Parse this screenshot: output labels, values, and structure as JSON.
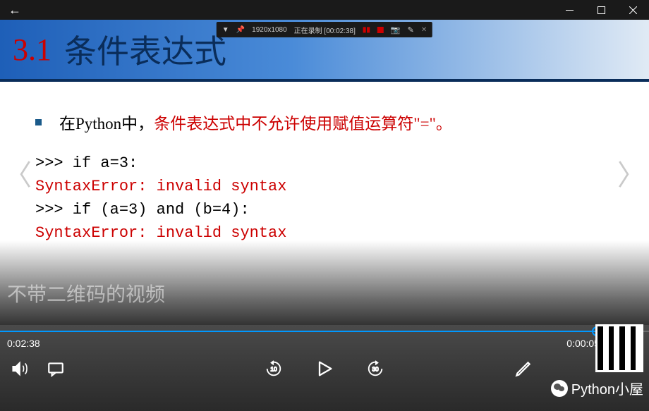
{
  "titlebar": {
    "back": "←"
  },
  "recording": {
    "resolution": "1920x1080",
    "status_label": "正在录制",
    "status_time": "[00:02:38]"
  },
  "slide": {
    "number": "3.1",
    "title": "条件表达式",
    "bullet_prefix": "在Python中，",
    "bullet_highlight": "条件表达式中不允许使用赋值运算符\"=\"。",
    "code": [
      {
        "text": ">>> if a=3:",
        "color": "black"
      },
      {
        "text": "SyntaxError: invalid syntax",
        "color": "red"
      },
      {
        "text": ">>> if (a=3) and (b=4):",
        "color": "black"
      },
      {
        "text": "SyntaxError: invalid syntax",
        "color": "red"
      }
    ]
  },
  "watermark": "不带二维码的视频",
  "player": {
    "current_time": "0:02:38",
    "remaining_time": "0:00:05",
    "rewind_seconds": "10",
    "forward_seconds": "30"
  },
  "channel": "Python小屋"
}
